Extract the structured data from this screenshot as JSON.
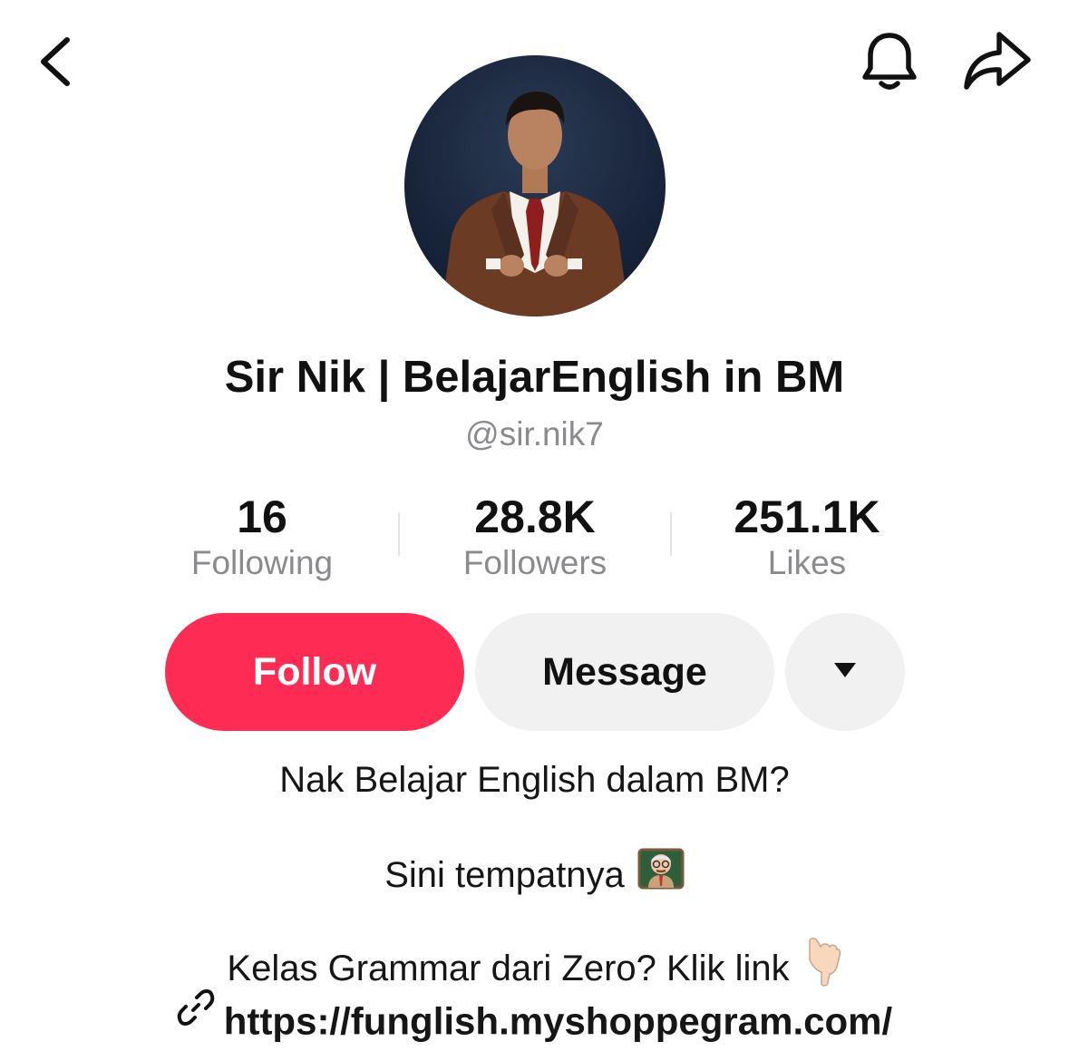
{
  "header": {
    "back_icon": "chevron-left-icon",
    "notifications_icon": "bell-icon",
    "share_icon": "share-arrow-icon"
  },
  "profile": {
    "display_name": "Sir Nik | BelajarEnglish in BM",
    "username": "@sir.nik7"
  },
  "stats": [
    {
      "value": "16",
      "label": "Following"
    },
    {
      "value": "28.8K",
      "label": "Followers"
    },
    {
      "value": "251.1K",
      "label": "Likes"
    }
  ],
  "actions": {
    "follow_label": "Follow",
    "message_label": "Message",
    "more_icon": "caret-down-icon"
  },
  "bio": {
    "line1": "Nak Belajar English dalam BM?",
    "line2": "Sini tempatnya",
    "line2_emoji": "teacher-emoji",
    "line3": "Kelas Grammar dari Zero? Klik link",
    "line3_emoji": "pointing-down-emoji"
  },
  "link": {
    "icon": "link-icon",
    "url": "https://funglish.myshoppegram.com/"
  },
  "colors": {
    "follow_button": "#fe2c55",
    "secondary_button": "#f1f1f2",
    "muted_text": "#8a8a8f"
  }
}
